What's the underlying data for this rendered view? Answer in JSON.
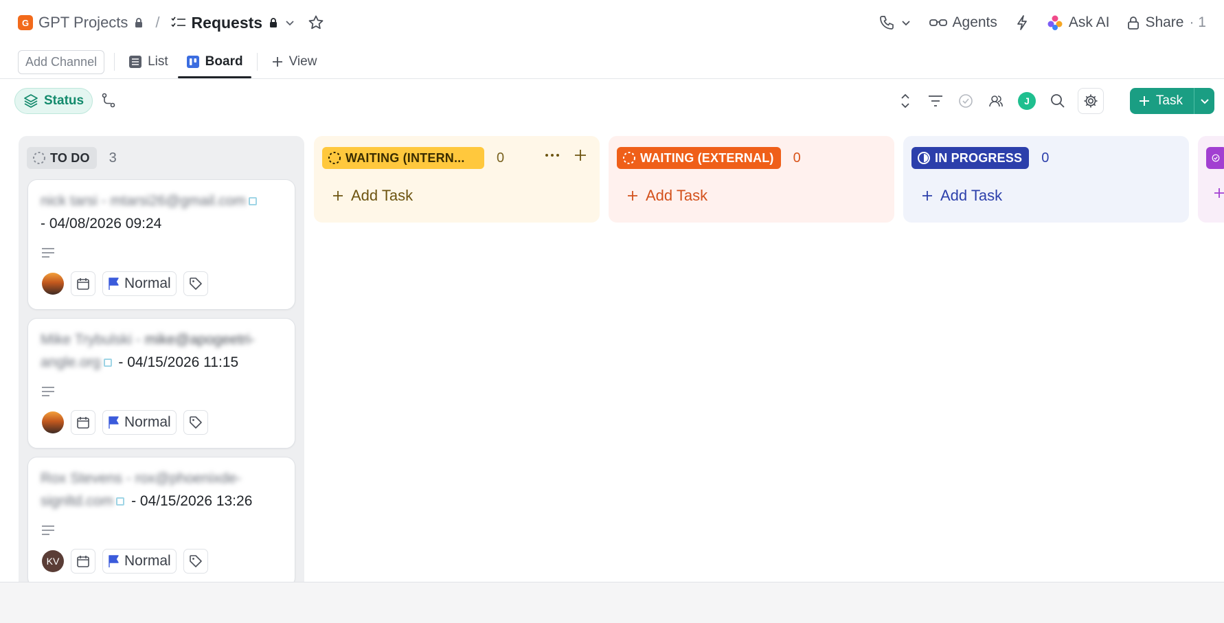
{
  "header": {
    "space_initial": "G",
    "space_name": "GPT Projects",
    "separator": "/",
    "list_name": "Requests",
    "right": {
      "agents_label": "Agents",
      "ask_ai_label": "Ask AI",
      "share_label": "Share",
      "share_count": "· 1"
    }
  },
  "views": {
    "add_channel": "Add Channel",
    "tabs": [
      {
        "label": "List",
        "active": false
      },
      {
        "label": "Board",
        "active": true
      }
    ],
    "add_view": "View"
  },
  "toolbar": {
    "status_label": "Status",
    "assignee_initial": "J",
    "task_button": "Task"
  },
  "columns": [
    {
      "status": "TO DO",
      "count": "3",
      "color": "#dfe1e4"
    },
    {
      "status": "WAITING (INTERN...",
      "count": "0",
      "add_task": "Add Task",
      "color": "#ffc83d"
    },
    {
      "status": "WAITING (EXTERNAL)",
      "count": "0",
      "add_task": "Add Task",
      "color": "#ef5f19"
    },
    {
      "status": "IN PROGRESS",
      "count": "0",
      "add_task": "Add Task",
      "color": "#2c3fab"
    },
    {
      "status": "",
      "count": "",
      "add_task": "",
      "color": "#a23fd1"
    }
  ],
  "cards": [
    {
      "title_blurred": "nick tarsi - mtarsi26@gmail.com",
      "title_plain": "- 04/08/2026 09:24",
      "assignee": "photo",
      "priority": "Normal"
    },
    {
      "title_blurred_a": "Mike Trybulski -",
      "title_mid": "mike@apogeetri-",
      "title_blurred_b": "angle.org",
      "title_plain": "- 04/15/2026 11:15",
      "assignee": "photo",
      "priority": "Normal"
    },
    {
      "title_blurred_a": "Rox Stevens - rox@phoenixde-",
      "title_blurred_b": "signltd.com",
      "title_plain": "- 04/15/2026 13:26",
      "assignee": "KV",
      "priority": "Normal"
    }
  ],
  "colors": {
    "accent": "#1a9e83",
    "priority_flag": "#3b5bdb"
  }
}
